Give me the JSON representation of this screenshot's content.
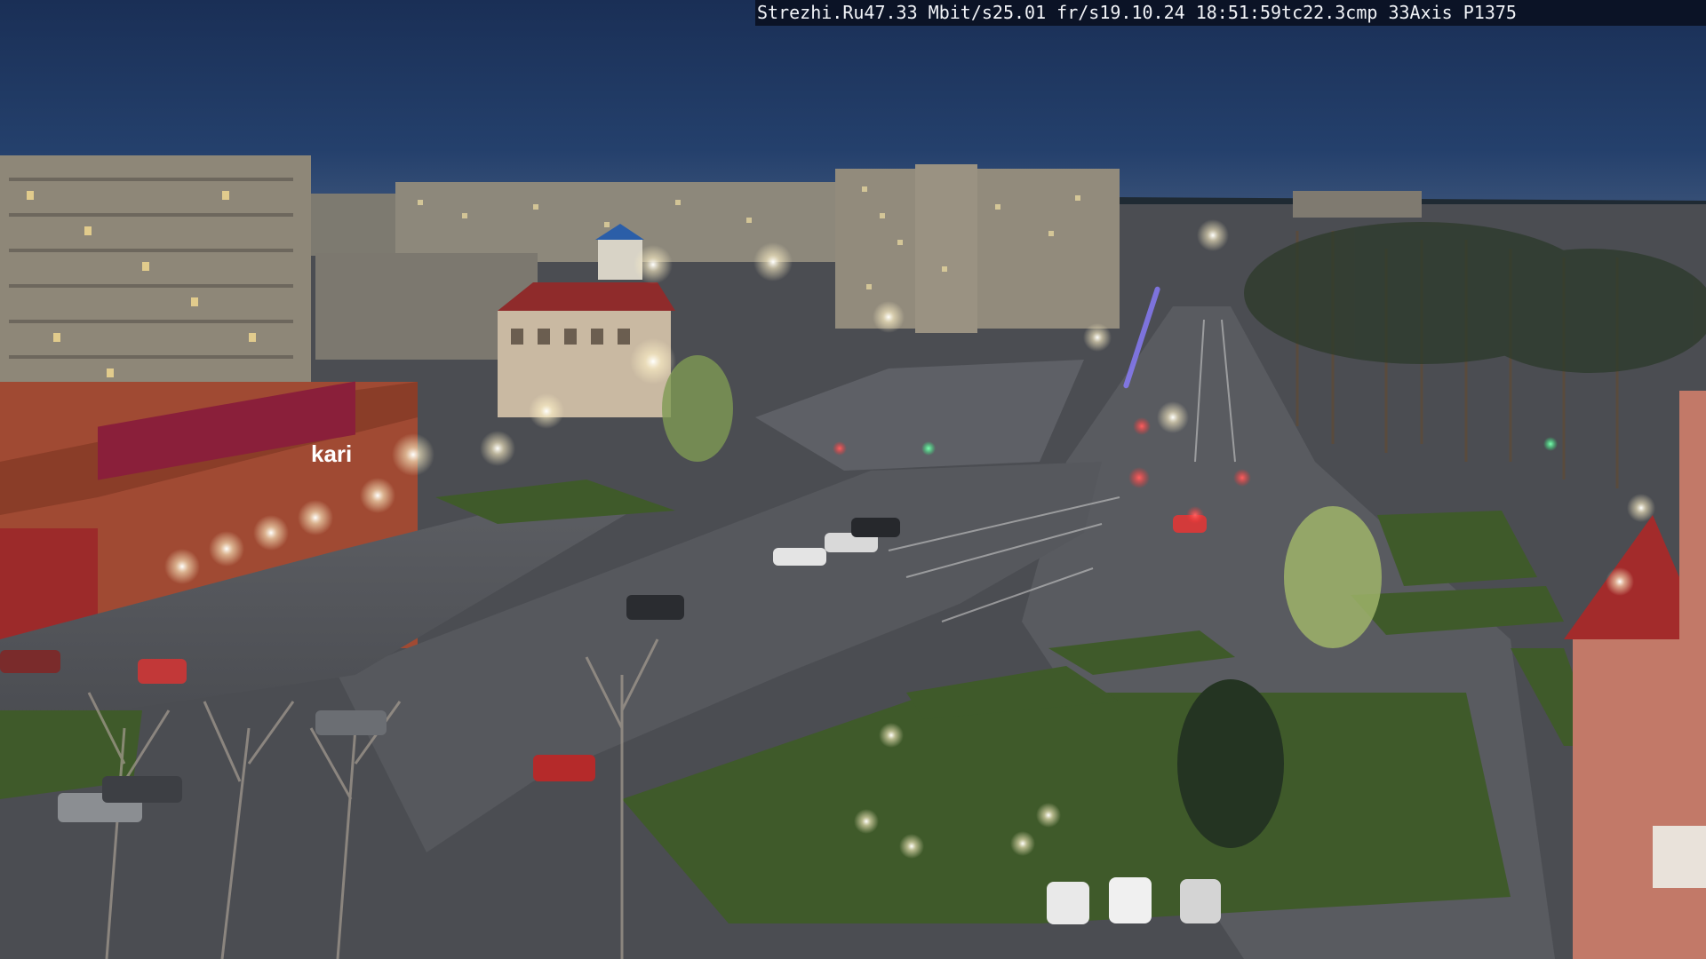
{
  "overlay": {
    "site": "Strezhi.Ru",
    "bitrate": "47.33 Mbit/s",
    "framerate": "25.01 fr/s",
    "datetime": "19.10.24 18:51:59",
    "tc": "tc22.3",
    "cmp": "cmp 33",
    "camera_model": "Axis P1375"
  },
  "signs": {
    "store_sign": "kari"
  },
  "colors": {
    "sky": "#1e3a66",
    "road": "#56595f",
    "grass": "#3f5a2a",
    "building_brick": "#b04a3b",
    "building_panel": "#8a8578",
    "streetlight": "#fff6d8"
  }
}
